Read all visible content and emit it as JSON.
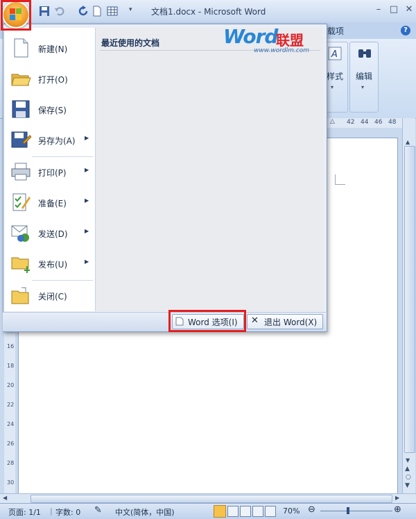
{
  "window": {
    "title": "文档1.docx - Microsoft Word",
    "controls": {
      "minimize": "–",
      "maximize": "□",
      "close": "✕"
    }
  },
  "ribbon": {
    "tab_partial": "载项",
    "groups": [
      {
        "label": "样式",
        "icon": "styles-icon"
      },
      {
        "label": "编辑",
        "icon": "find-binoculars-icon"
      }
    ],
    "ruler_ticks": [
      "42",
      "44",
      "46",
      "48"
    ]
  },
  "vertical_ruler": [
    "16",
    "18",
    "20",
    "22",
    "24",
    "26",
    "28",
    "30"
  ],
  "office_menu": {
    "recent_documents_title": "最近使用的文档",
    "items": [
      {
        "id": "new",
        "label": "新建(N)",
        "icon": "new-document-icon",
        "submenu": false
      },
      {
        "id": "open",
        "label": "打开(O)",
        "icon": "open-folder-icon",
        "submenu": false
      },
      {
        "id": "save",
        "label": "保存(S)",
        "icon": "save-icon",
        "submenu": false
      },
      {
        "id": "saveas",
        "label": "另存为(A)",
        "icon": "save-as-icon",
        "submenu": true
      },
      {
        "id": "print",
        "label": "打印(P)",
        "icon": "printer-icon",
        "submenu": true
      },
      {
        "id": "prepare",
        "label": "准备(E)",
        "icon": "prepare-icon",
        "submenu": true
      },
      {
        "id": "send",
        "label": "发送(D)",
        "icon": "send-icon",
        "submenu": true
      },
      {
        "id": "publish",
        "label": "发布(U)",
        "icon": "publish-icon",
        "submenu": true
      },
      {
        "id": "close",
        "label": "关闭(C)",
        "icon": "close-document-icon",
        "submenu": false
      }
    ],
    "options_button": "Word 选项(I)",
    "exit_button": "退出 Word(X)"
  },
  "watermark": {
    "word": "Word",
    "cn": "联盟",
    "url": "www.wordlm.com"
  },
  "statusbar": {
    "page": "页面: 1/1",
    "words": "字数: 0",
    "language": "中文(简体，中国)",
    "zoom": "70%"
  },
  "colors": {
    "highlight": "#e41e1e",
    "office_orange": "#f09b2a",
    "ribbon_blue": "#c8dbf1"
  }
}
